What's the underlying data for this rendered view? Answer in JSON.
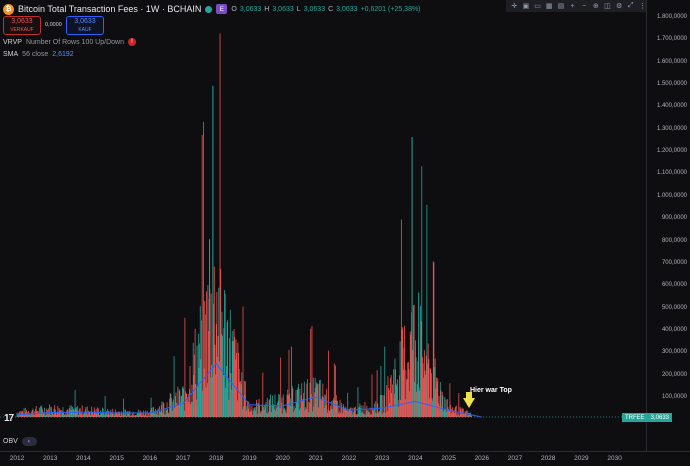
{
  "header": {
    "symbol_logo": "₿",
    "title": "Bitcoin Total Transaction Fees · 1W · BCHAIN",
    "e_badge": "E",
    "ohlc": {
      "o_label": "O",
      "o": "3,0633",
      "h_label": "H",
      "h": "3,0633",
      "l_label": "L",
      "l": "3,0633",
      "c_label": "C",
      "c": "3,0633",
      "change": "+0,6201 (+25,38%)"
    }
  },
  "trade": {
    "sell_price": "3,0633",
    "sell_label": "VERKAUF",
    "spread": "0,0000",
    "buy_price": "3,0633",
    "buy_label": "KAUF"
  },
  "indicators": {
    "vrvp": {
      "name": "VRVP",
      "params": "Number Of Rows 100 Up/Down",
      "warn": "!"
    },
    "sma": {
      "name": "SMA",
      "params": "56 close",
      "value": "2,6192"
    }
  },
  "toolbar_icons": [
    "crosshair-icon",
    "screenshot-icon",
    "ruler-icon",
    "table-icon",
    "calendar-icon",
    "plus-icon",
    "zoom-out-icon",
    "zoom-in-icon",
    "chart-icon",
    "settings-icon",
    "expand-icon",
    "more-icon"
  ],
  "price_axis": {
    "ticks": [
      "1.800,0000",
      "1.700,0000",
      "1.600,0000",
      "1.500,0000",
      "1.400,0000",
      "1.300,0000",
      "1.200,0000",
      "1.100,0000",
      "1.000,0000",
      "900,0000",
      "800,0000",
      "700,0000",
      "600,0000",
      "500,0000",
      "400,0000",
      "300,0000",
      "200,0000",
      "100,0000"
    ],
    "last_symbol": "TRFEE",
    "last_value": "3,0633"
  },
  "time_axis": {
    "ticks": [
      "2012",
      "2013",
      "2014",
      "2015",
      "2016",
      "2017",
      "2018",
      "2019",
      "2020",
      "2021",
      "2022",
      "2023",
      "2024",
      "2025",
      "2026",
      "2027",
      "2028",
      "2029",
      "2030"
    ]
  },
  "annotation": {
    "text": "Hier war Top"
  },
  "obv": {
    "name": "OBV"
  },
  "tv_logo": "17",
  "colors": {
    "up": "#26a69a",
    "down": "#ef5350",
    "sma": "#2962ff",
    "background": "#0e0e10",
    "arrow": "#f2e34a"
  },
  "chart_data": {
    "type": "bar",
    "title": "Bitcoin Total Transaction Fees · 1W · BCHAIN",
    "ylim": [
      0,
      1800000
    ],
    "x": [
      "2012",
      "2013",
      "2014",
      "2015",
      "2016",
      "2017",
      "2018",
      "2019",
      "2020",
      "2021",
      "2022",
      "2023",
      "2024",
      "2025",
      "2026"
    ],
    "series": [
      {
        "name": "TRFEE",
        "values": [
          20000,
          35000,
          30000,
          22000,
          20000,
          90000,
          500000,
          40000,
          70000,
          110000,
          25000,
          60000,
          350000,
          40000,
          3
        ]
      },
      {
        "name": "SMA",
        "values": [
          10000,
          20000,
          22000,
          18000,
          18000,
          60000,
          240000,
          55000,
          50000,
          90000,
          30000,
          40000,
          70000,
          30000,
          3
        ]
      }
    ],
    "peaks": [
      {
        "x": "2017.9",
        "y": 1490000
      },
      {
        "x": "2023.9",
        "y": 1260000
      },
      {
        "x": "2024.1",
        "y": 560000
      },
      {
        "x": "2017.8",
        "y": 800000
      }
    ]
  }
}
